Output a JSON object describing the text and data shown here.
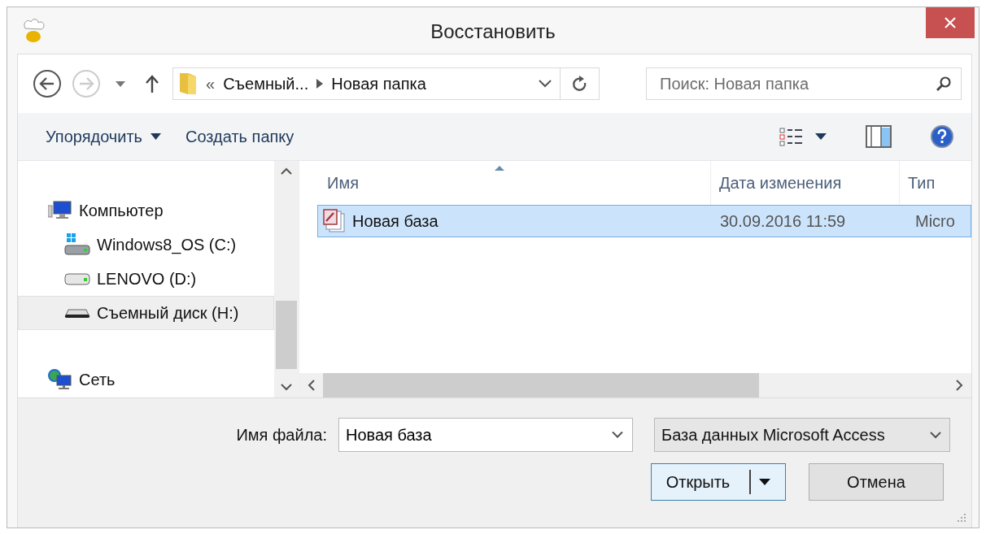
{
  "window": {
    "title": "Восстановить"
  },
  "address_bar": {
    "overflow": "«",
    "crumbs": [
      "Съемный...",
      "Новая папка"
    ]
  },
  "search": {
    "placeholder": "Поиск: Новая папка"
  },
  "toolbar": {
    "organize": "Упорядочить",
    "new_folder": "Создать папку"
  },
  "nav_tree": [
    {
      "label": "Компьютер",
      "kind": "computer",
      "selected": false,
      "children": [
        {
          "label": "Windows8_OS (C:)",
          "kind": "system-drive",
          "selected": false
        },
        {
          "label": "LENOVO (D:)",
          "kind": "drive",
          "selected": false
        },
        {
          "label": "Съемный диск (H:)",
          "kind": "removable",
          "selected": true
        }
      ]
    },
    {
      "label": "Сеть",
      "kind": "network",
      "selected": false
    }
  ],
  "table": {
    "columns": [
      "Имя",
      "Дата изменения",
      "Тип"
    ],
    "rows": [
      {
        "name": "Новая база",
        "date": "30.09.2016 11:59",
        "type": "Micro",
        "selected": true
      }
    ]
  },
  "file_name": {
    "label": "Имя файла:",
    "value": "Новая база"
  },
  "file_type": {
    "value": "База данных Microsoft Access"
  },
  "buttons": {
    "open": "Открыть",
    "cancel": "Отмена"
  }
}
